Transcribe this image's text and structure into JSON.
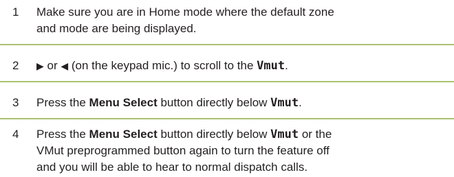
{
  "colors": {
    "rule": "#a9c070",
    "text": "#231f20"
  },
  "steps": [
    {
      "number": "1",
      "line1": "Make sure you are in Home mode where the default zone",
      "line2": "and mode are being displayed."
    },
    {
      "number": "2",
      "right_arrow": "▶",
      "or": " or ",
      "left_arrow": "◀",
      "text": " (on the keypad mic.) to scroll to the ",
      "code": "Vmut",
      "end": "."
    },
    {
      "number": "3",
      "pre": "Press the ",
      "bold": "Menu Select",
      "mid": " button directly below ",
      "code": "Vmut",
      "end": "."
    },
    {
      "number": "4",
      "pre": "Press the ",
      "bold": "Menu Select",
      "mid": " button directly below ",
      "code": "Vmut",
      "post": " or the",
      "line2": "VMut preprogrammed button again to turn the feature off",
      "line3": "and you will be able to hear to normal dispatch calls."
    }
  ]
}
